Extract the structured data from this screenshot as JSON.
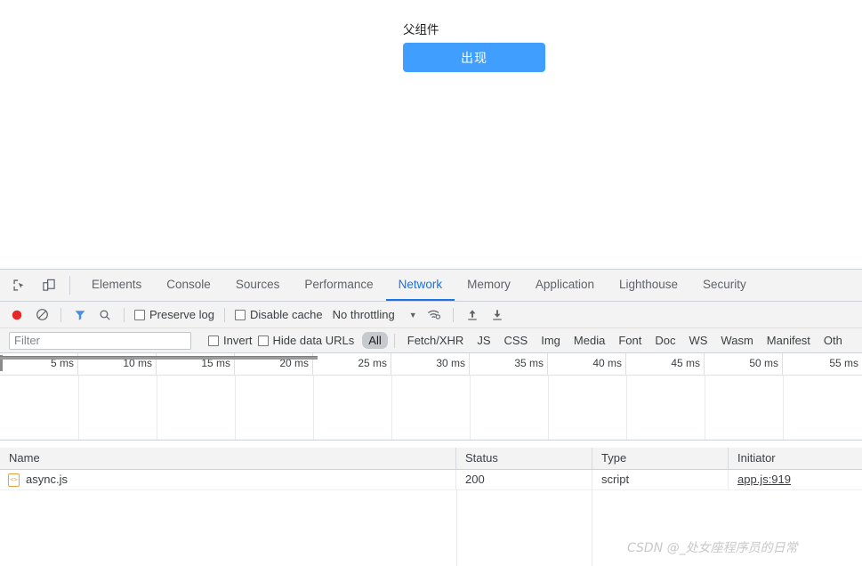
{
  "page": {
    "parent_label": "父组件",
    "appear_button": "出现"
  },
  "devtools": {
    "tool_icons": [
      {
        "name": "inspect-element-icon"
      },
      {
        "name": "device-toolbar-icon"
      }
    ],
    "tabs": [
      {
        "label": "Elements",
        "active": false
      },
      {
        "label": "Console",
        "active": false
      },
      {
        "label": "Sources",
        "active": false
      },
      {
        "label": "Performance",
        "active": false
      },
      {
        "label": "Network",
        "active": true
      },
      {
        "label": "Memory",
        "active": false
      },
      {
        "label": "Application",
        "active": false
      },
      {
        "label": "Lighthouse",
        "active": false
      },
      {
        "label": "Security",
        "active": false
      }
    ],
    "active_tab": "Network",
    "accent_color": "#1a73e8",
    "toolbar": {
      "record_title": "record-button",
      "clear_title": "clear-button",
      "filter_title": "filter-button",
      "search_title": "search-button",
      "preserve_log": "Preserve log",
      "disable_cache": "Disable cache",
      "throttling": "No throttling",
      "caret": "▼",
      "wifi_title": "network-conditions",
      "import_title": "import-har",
      "export_title": "export-har"
    },
    "filter_row": {
      "placeholder": "Filter",
      "invert": "Invert",
      "hide_data_urls": "Hide data URLs",
      "types": [
        {
          "label": "All",
          "active": true
        },
        {
          "label": "Fetch/XHR",
          "active": false
        },
        {
          "label": "JS",
          "active": false
        },
        {
          "label": "CSS",
          "active": false
        },
        {
          "label": "Img",
          "active": false
        },
        {
          "label": "Media",
          "active": false
        },
        {
          "label": "Font",
          "active": false
        },
        {
          "label": "Doc",
          "active": false
        },
        {
          "label": "WS",
          "active": false
        },
        {
          "label": "Wasm",
          "active": false
        },
        {
          "label": "Manifest",
          "active": false
        },
        {
          "label": "Oth",
          "active": false
        }
      ]
    },
    "overview": {
      "ticks": [
        "5 ms",
        "10 ms",
        "15 ms",
        "20 ms",
        "25 ms",
        "30 ms",
        "35 ms",
        "40 ms",
        "45 ms",
        "50 ms",
        "55 ms"
      ]
    },
    "requests": {
      "columns": [
        "Name",
        "Status",
        "Type",
        "Initiator"
      ],
      "rows": [
        {
          "icon": "script-file-icon",
          "name": "async.js",
          "status": "200",
          "type": "script",
          "initiator": "app.js:919"
        }
      ]
    }
  },
  "watermark": "CSDN @_处女座程序员的日常"
}
